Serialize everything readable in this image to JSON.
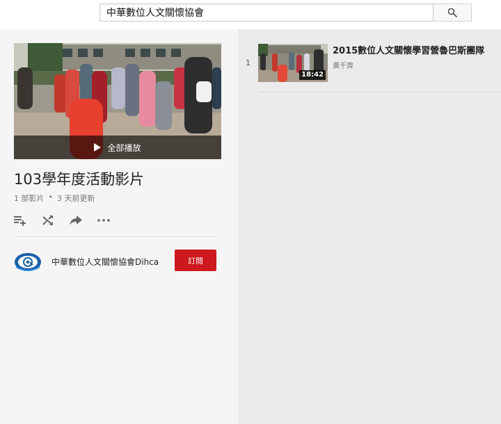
{
  "search": {
    "value": "中華數位人文關懷協會",
    "placeholder": ""
  },
  "playlist": {
    "title": "103學年度活動影片",
    "video_count": "1 部影片",
    "separator": "•",
    "updated": "3 天前更新",
    "play_all_label": "全部播放",
    "actions": [
      "add-to-queue-icon",
      "shuffle-icon",
      "share-icon",
      "more-icon"
    ]
  },
  "channel": {
    "name": "中華數位人文關懷協會Dihca",
    "subscribe_label": "訂閱"
  },
  "videos": [
    {
      "index": "1",
      "title": "2015數位人文關懷學習營魯巴斯團隊",
      "author": "黃千齊",
      "duration": "18:42"
    }
  ],
  "colors": {
    "subscribe": "#cc181e",
    "left_panel": "#f5f5f5",
    "right_panel": "#ebebeb"
  }
}
